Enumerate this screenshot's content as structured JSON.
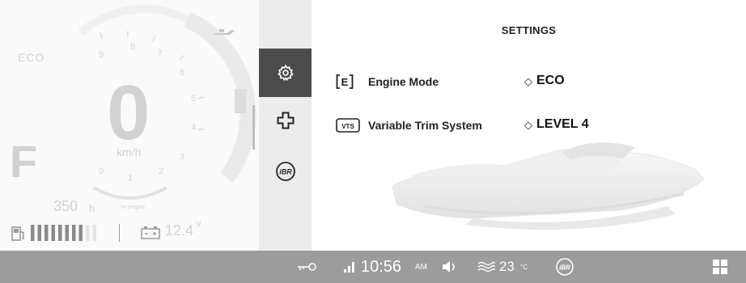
{
  "gauge": {
    "mode_label": "ECO",
    "speed": "0",
    "speed_unit": "km/h",
    "gear": "F",
    "hours_value": "350",
    "hours_unit": "h",
    "subtext": "hr engine",
    "voltage": "12.4",
    "voltage_unit": "V",
    "fuel_level": 0.8,
    "rpm_ticks": [
      "9",
      "8",
      "7",
      "6",
      "5",
      "4",
      "3",
      "2",
      "1",
      "0"
    ]
  },
  "nav": {
    "items": [
      {
        "name": "settings",
        "icon": "gear-icon",
        "active": true
      },
      {
        "name": "service",
        "icon": "wrench-cross-icon",
        "active": false
      },
      {
        "name": "ibr",
        "icon": "ibr-icon",
        "active": false,
        "label": "iBR"
      }
    ]
  },
  "settings": {
    "title": "SETTINGS",
    "rows": [
      {
        "icon_label": "E",
        "label": "Engine Mode",
        "value": "ECO"
      },
      {
        "icon_label": "VTS",
        "label": "Variable Trim System",
        "value": "LEVEL 4"
      }
    ]
  },
  "status": {
    "time": "10:56",
    "ampm": "AM",
    "temperature": "23",
    "temperature_unit": "°C",
    "ibr_label": "iBR"
  },
  "colors": {
    "nav_active": "#4c4c4c",
    "nav_bg": "#ececec",
    "status_bar": "#9c9c9c",
    "gauge_bg": "#fafafa"
  }
}
